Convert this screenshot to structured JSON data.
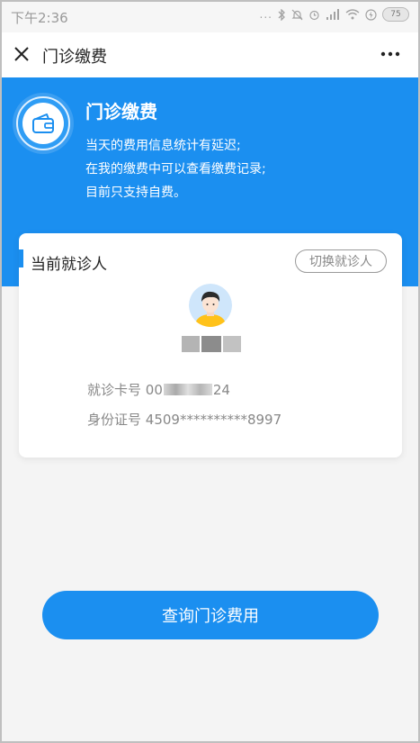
{
  "status_bar": {
    "time": "下午2:36",
    "dots": "...",
    "battery": "75"
  },
  "nav": {
    "title": "门诊缴费",
    "close_icon": "close-icon",
    "more_icon": "more-icon"
  },
  "hero": {
    "title": "门诊缴费",
    "lines": [
      "当天的费用信息统计有延迟;",
      "在我的缴费中可以查看缴费记录;",
      "目前只支持自费。"
    ],
    "icon": "wallet-icon"
  },
  "patient_card": {
    "title": "当前就诊人",
    "switch_label": "切换就诊人",
    "card_no_label": "就诊卡号",
    "card_no_prefix": "00",
    "card_no_suffix": "24",
    "id_label": "身份证号",
    "id_value": "4509**********8997"
  },
  "actions": {
    "query_label": "查询门诊费用"
  },
  "colors": {
    "primary": "#1b8ff0",
    "background": "#f4f4f4"
  }
}
